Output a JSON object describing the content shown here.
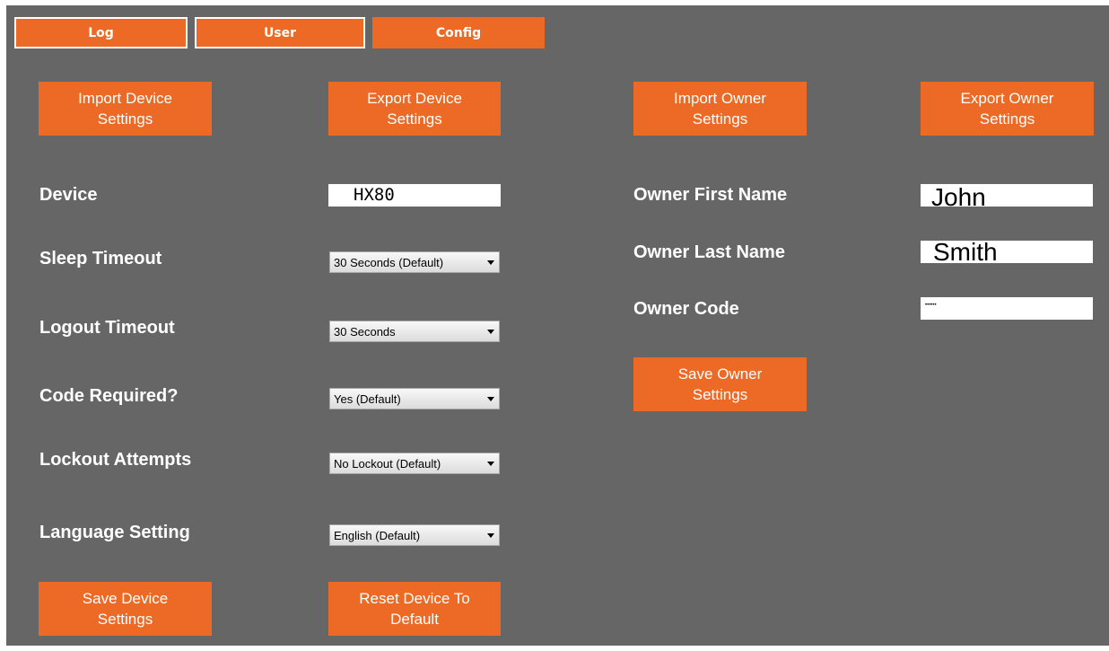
{
  "tabs": [
    {
      "label": "Log"
    },
    {
      "label": "User"
    },
    {
      "label": "Config"
    }
  ],
  "buttons": {
    "import_device": "Import Device\nSettings",
    "export_device": "Export Device\nSettings",
    "import_owner": "Import Owner\nSettings",
    "export_owner": "Export Owner\nSettings",
    "save_owner": "Save Owner\nSettings",
    "save_device": "Save Device\nSettings",
    "reset_device": "Reset Device To\nDefault"
  },
  "device_form": {
    "device_label": "Device",
    "device_value": "HX80",
    "sleep_label": "Sleep Timeout",
    "sleep_value": "30 Seconds (Default)",
    "logout_label": "Logout Timeout",
    "logout_value": "30 Seconds",
    "code_label": "Code Required?",
    "code_value": "Yes (Default)",
    "lockout_label": "Lockout Attempts",
    "lockout_value": "No Lockout (Default)",
    "language_label": "Language Setting",
    "language_value": "English (Default)"
  },
  "owner_form": {
    "first_name_label": "Owner First Name",
    "first_name_value": "John",
    "last_name_label": "Owner Last Name",
    "last_name_value": "Smith",
    "code_label": "Owner Code",
    "code_value": "••••••"
  },
  "colors": {
    "panel": "#666666",
    "accent": "#ec6a25"
  }
}
